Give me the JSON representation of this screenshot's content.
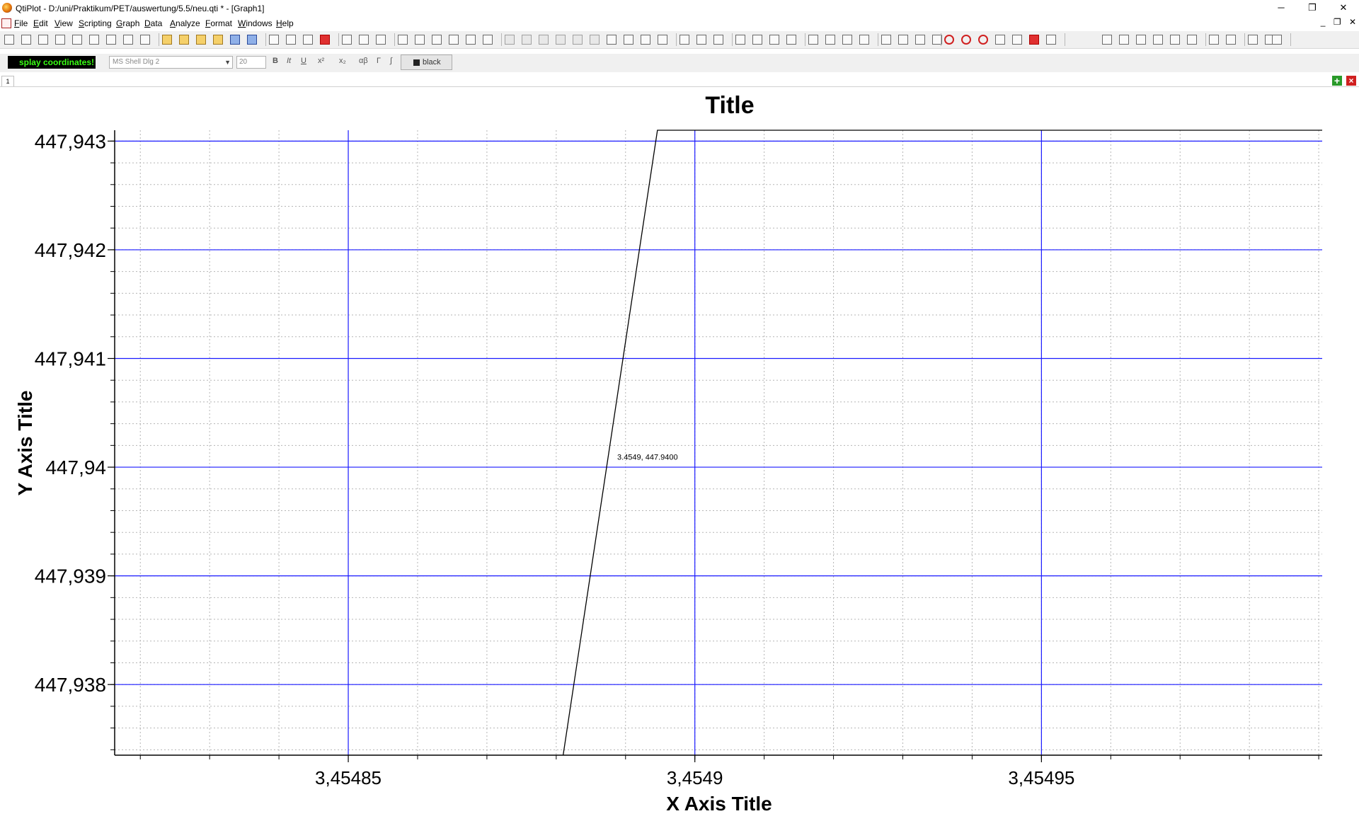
{
  "window": {
    "title": "QtiPlot - D:/uni/Praktikum/PET/auswertung/5.5/neu.qti * - [Graph1]",
    "controls": {
      "minimize": "─",
      "restore": "❐",
      "close": "✕"
    }
  },
  "menu": [
    "File",
    "Edit",
    "View",
    "Scripting",
    "Graph",
    "Data",
    "Analyze",
    "Format",
    "Windows",
    "Help"
  ],
  "mdi_controls": [
    "_",
    "❐",
    "✕"
  ],
  "format_toolbar": {
    "coordinates_text": "splay coordinates!",
    "font": "MS Shell Dlg 2",
    "font_size": "20",
    "bold": "B",
    "italic": "It",
    "underline": "U",
    "superscript": "x²",
    "subscript": "x₂",
    "greek": "αβ",
    "capital_greek": "Γ",
    "integral": "∫",
    "color": "black"
  },
  "layer_tab": "1",
  "chart_data": {
    "type": "line",
    "title": "Title",
    "xlabel": "X Axis Title",
    "ylabel": "Y Axis Title",
    "xlim": [
      3.4548163,
      3.4549905
    ],
    "ylim": [
      447.93735,
      447.9431
    ],
    "x_major_ticks": [
      3.45485,
      3.4549,
      3.45495
    ],
    "x_tick_labels": [
      "3,45485",
      "3,4549",
      "3,45495"
    ],
    "y_major_ticks": [
      447.938,
      447.939,
      447.94,
      447.941,
      447.942,
      447.943
    ],
    "y_tick_labels": [
      "447,938",
      "447,939",
      "447,94",
      "447,941",
      "447,942",
      "447,943"
    ],
    "grid": {
      "major": true,
      "minor": true,
      "major_color": "#1a1aff",
      "minor_color": "#b5b5b5"
    },
    "series": [
      {
        "color": "#000000",
        "points": [
          [
            3.454881,
            447.93735
          ],
          [
            3.4548946,
            447.9431
          ],
          [
            3.4549905,
            447.9431
          ]
        ]
      }
    ],
    "annotation": {
      "text": "3.4549, 447.9400",
      "x": 3.4548888,
      "y": 447.94007
    }
  },
  "colors": {
    "axis": "#000000",
    "coords_bg": "#000000",
    "coords_fg": "#39ff14"
  }
}
